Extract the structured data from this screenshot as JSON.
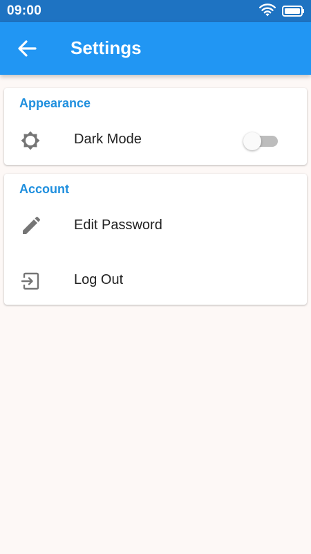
{
  "status_bar": {
    "time": "09:00",
    "icons": [
      "wifi-icon",
      "battery-icon"
    ]
  },
  "app_bar": {
    "back_icon": "arrow-left-icon",
    "title": "Settings"
  },
  "sections": [
    {
      "title": "Appearance",
      "items": [
        {
          "icon": "brightness-icon",
          "label": "Dark Mode",
          "toggle": false
        }
      ]
    },
    {
      "title": "Account",
      "items": [
        {
          "icon": "pencil-icon",
          "label": "Edit Password"
        },
        {
          "icon": "logout-icon",
          "label": "Log Out"
        }
      ]
    }
  ],
  "colors": {
    "status_bar": "#1e73c2",
    "app_bar": "#2196f3",
    "section_title": "#1f8fde",
    "background": "#fdf8f6",
    "icon": "#757575"
  }
}
